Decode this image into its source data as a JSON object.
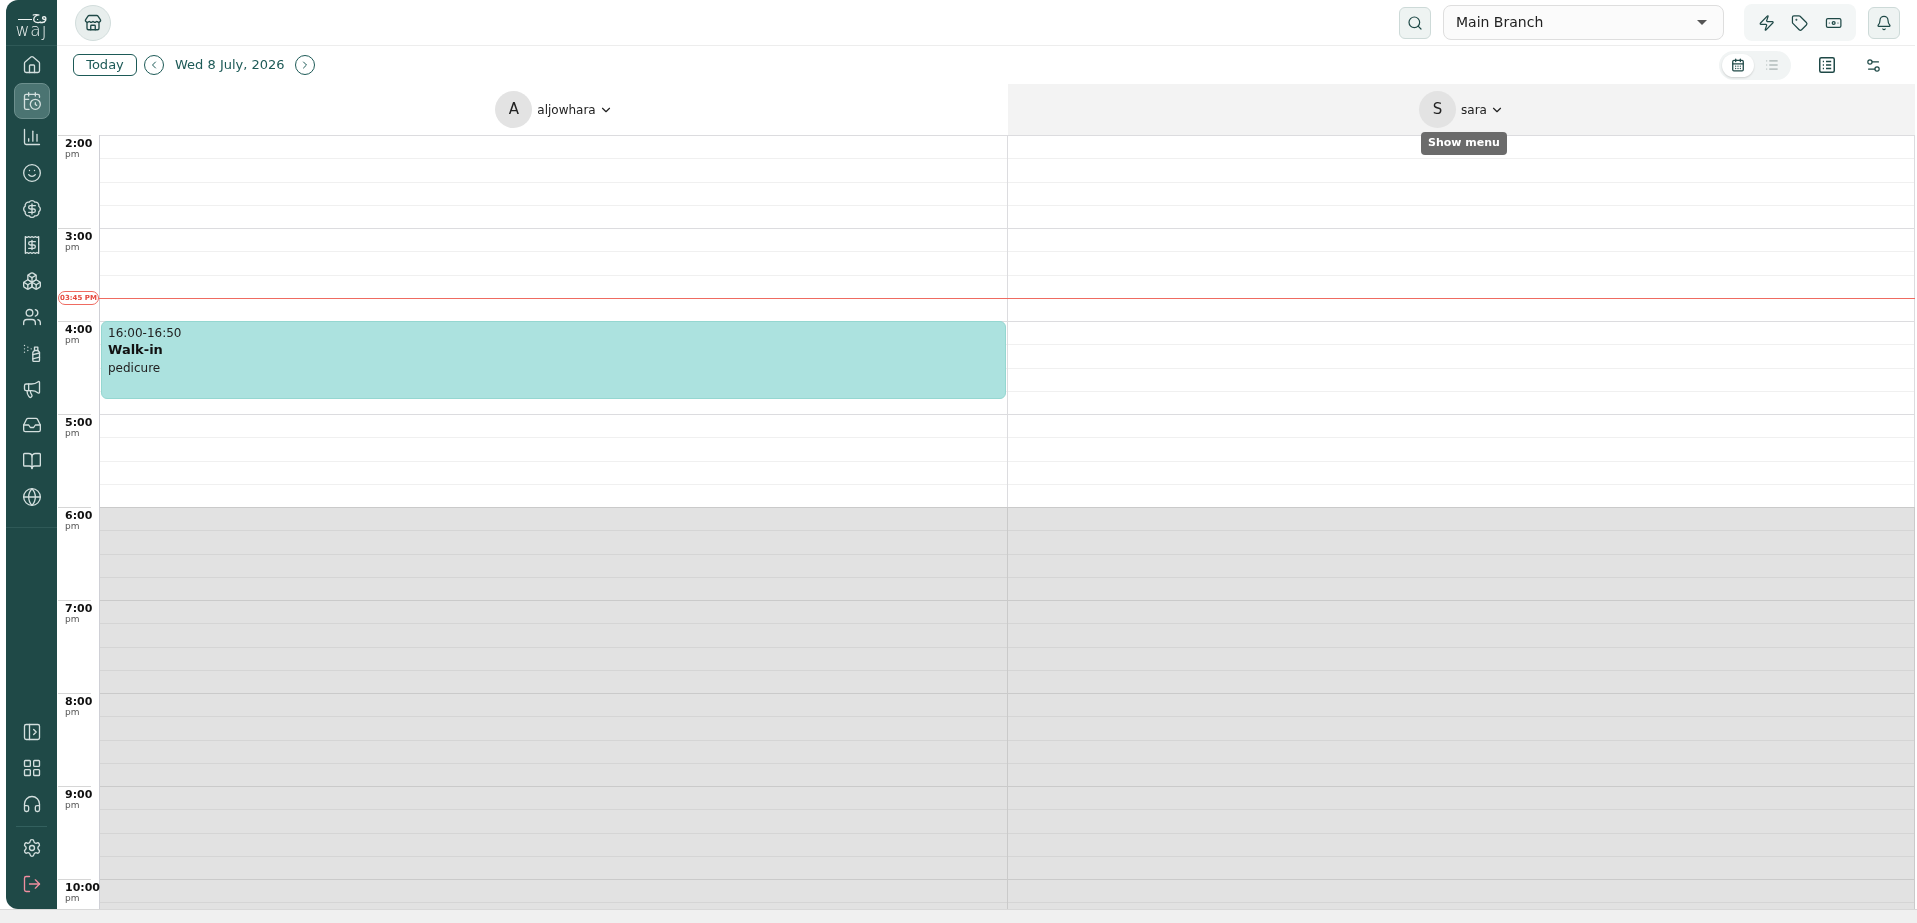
{
  "sidebar": {
    "logo": {
      "arabic": "وج",
      "latin": "waj"
    },
    "nav": [
      {
        "selected": false
      },
      {
        "selected": true
      },
      {
        "selected": false
      },
      {
        "selected": false
      },
      {
        "selected": false
      },
      {
        "selected": false
      },
      {
        "selected": false
      },
      {
        "selected": false
      },
      {
        "selected": false
      },
      {
        "selected": false
      },
      {
        "selected": false
      },
      {
        "selected": false
      },
      {
        "selected": false
      }
    ],
    "utility": [
      {
        "selected": false
      },
      {
        "selected": false
      },
      {
        "selected": false
      }
    ],
    "account": [
      {
        "selected": false
      },
      {
        "selected": false
      }
    ]
  },
  "header": {
    "branch_select": {
      "value": "Main Branch"
    }
  },
  "toolbar": {
    "today_button": "Today",
    "date": "Wed 8 July, 2026",
    "views": [
      {
        "selected": true
      },
      {
        "selected": false
      }
    ]
  },
  "columns": [
    {
      "avatar": "A",
      "name": "aljowhara",
      "hovered": false,
      "events": [
        {
          "time": "16:00-16:50",
          "title": "Walk-in",
          "service": "pedicure",
          "color": "#ace2df"
        }
      ]
    },
    {
      "avatar": "S",
      "name": "sara",
      "hovered": true,
      "tooltip": "Show menu"
    }
  ],
  "hours": [
    {
      "time": "2:00",
      "period": "pm",
      "closed": false
    },
    {
      "time": "3:00",
      "period": "pm",
      "closed": false,
      "now": {
        "label": "03:45 PM"
      }
    },
    {
      "time": "4:00",
      "period": "pm",
      "closed": false
    },
    {
      "time": "5:00",
      "period": "pm",
      "closed": false
    },
    {
      "time": "6:00",
      "period": "pm",
      "closed": true
    },
    {
      "time": "7:00",
      "period": "pm",
      "closed": true
    },
    {
      "time": "8:00",
      "period": "pm",
      "closed": true
    },
    {
      "time": "9:00",
      "period": "pm",
      "closed": true
    },
    {
      "time": "10:00",
      "period": "pm",
      "closed": true
    }
  ]
}
